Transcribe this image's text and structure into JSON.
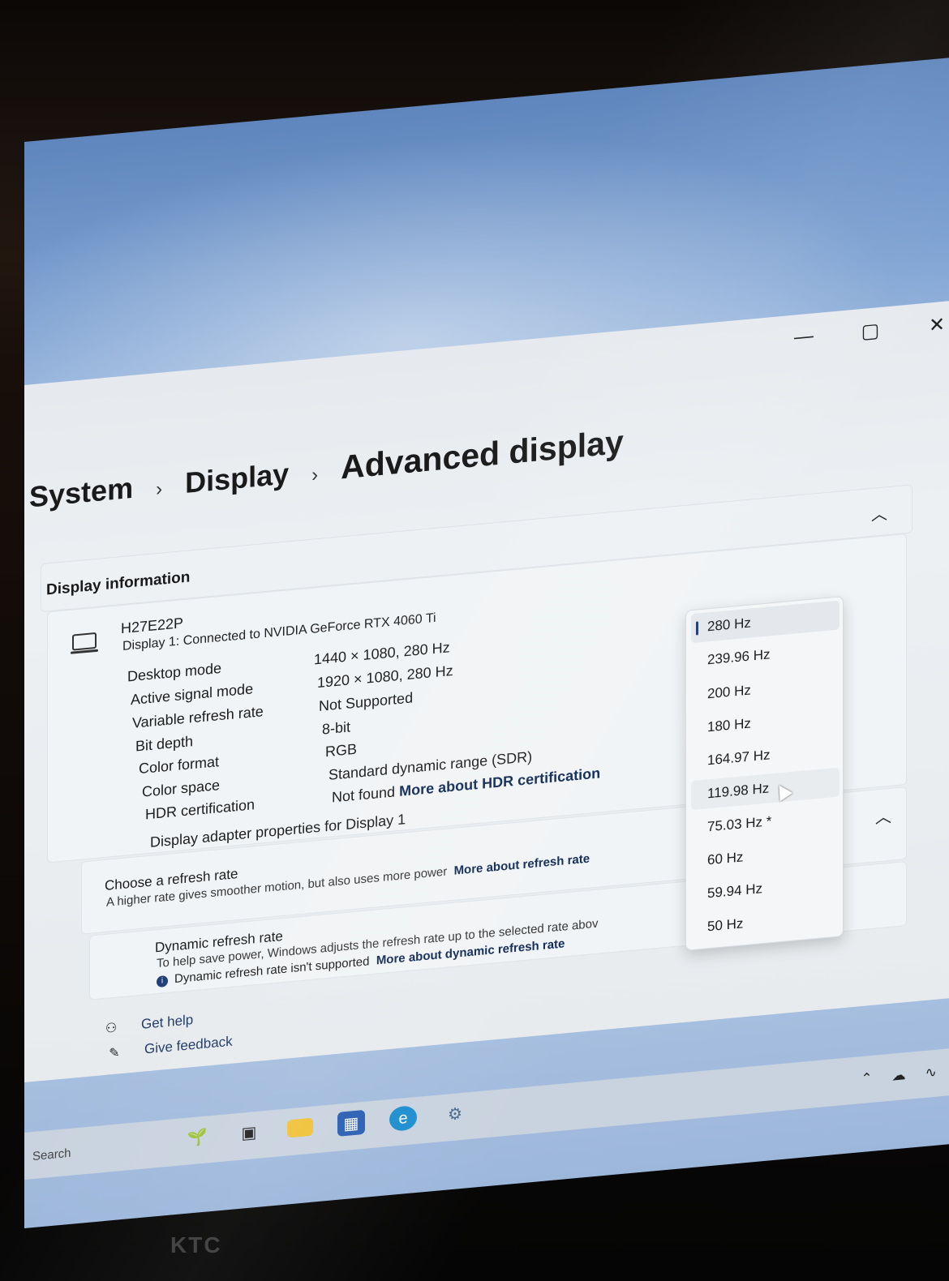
{
  "window": {
    "controls": {
      "minimize": "—",
      "maximize": "▢",
      "close": "✕"
    }
  },
  "breadcrumb": {
    "items": [
      "System",
      "Display",
      "Advanced display"
    ],
    "separator": "›"
  },
  "display_info": {
    "section_title": "Display information",
    "monitor_name": "H27E22P",
    "monitor_sub": "Display 1: Connected to NVIDIA GeForce RTX 4060 Ti",
    "rows": [
      {
        "key": "Desktop mode",
        "value": "1440 × 1080, 280 Hz"
      },
      {
        "key": "Active signal mode",
        "value": "1920 × 1080, 280 Hz"
      },
      {
        "key": "Variable refresh rate",
        "value": "Not Supported"
      },
      {
        "key": "Bit depth",
        "value": "8-bit"
      },
      {
        "key": "Color format",
        "value": "RGB"
      },
      {
        "key": "Color space",
        "value": "Standard dynamic range (SDR)"
      },
      {
        "key": "HDR certification",
        "value": "Not found",
        "link": "More about HDR certification"
      }
    ],
    "adapter_link": "Display adapter properties for Display 1"
  },
  "refresh": {
    "title": "Choose a refresh rate",
    "subtitle": "A higher rate gives smoother motion, but also uses more power",
    "link": "More about refresh rate",
    "options": [
      "280 Hz",
      "239.96 Hz",
      "200 Hz",
      "180 Hz",
      "164.97 Hz",
      "119.98 Hz",
      "75.03 Hz *",
      "60 Hz",
      "59.94 Hz",
      "50 Hz"
    ],
    "selected_index": 0,
    "hover_index": 5
  },
  "dynamic": {
    "title": "Dynamic refresh rate",
    "subtitle": "To help save power, Windows adjusts the refresh rate up to the selected rate abov",
    "note": "Dynamic refresh rate isn't supported",
    "link": "More about dynamic refresh rate"
  },
  "help": {
    "get_help": "Get help",
    "give_feedback": "Give feedback"
  },
  "taskbar": {
    "search_label": "Search",
    "icons": [
      "plant-icon",
      "task-view-icon",
      "file-explorer-icon",
      "store-icon",
      "edge-icon",
      "settings-icon"
    ],
    "tray": [
      "chevron-up-icon",
      "cloud-icon",
      "wifi-icon",
      "volume-icon"
    ]
  },
  "bezel_brand": "KTC",
  "colors": {
    "link": "#0f2a55",
    "accent": "#1f3d78"
  }
}
